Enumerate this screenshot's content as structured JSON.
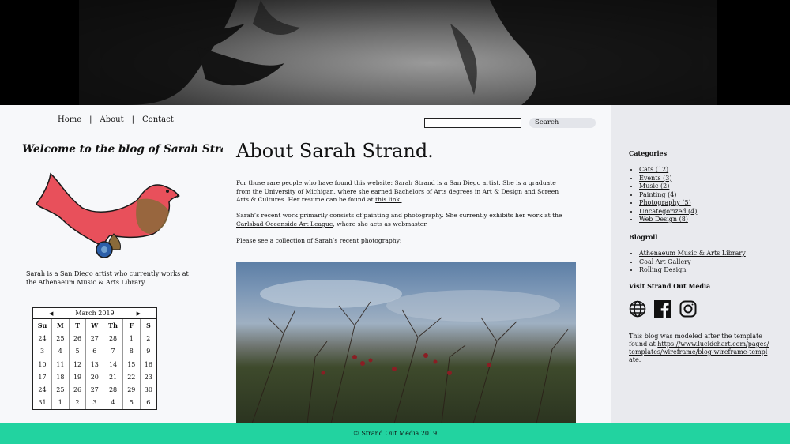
{
  "nav": {
    "home": "Home",
    "about": "About",
    "contact": "Contact",
    "sep": "|"
  },
  "search": {
    "button": "Search",
    "placeholder": ""
  },
  "sidebar_left": {
    "welcome": "Welcome to the blog of Sarah Strand.",
    "bio": "Sarah is a San Diego artist who currently works at the Athenaeum Music & Arts Library.",
    "calendar": {
      "month": "March 2019",
      "prev_icon": "◀",
      "next_icon": "▶",
      "days": [
        "Su",
        "M",
        "T",
        "W",
        "Th",
        "F",
        "S"
      ],
      "weeks": [
        [
          "24",
          "25",
          "26",
          "27",
          "28",
          "1",
          "2"
        ],
        [
          "3",
          "4",
          "5",
          "6",
          "7",
          "8",
          "9"
        ],
        [
          "10",
          "11",
          "12",
          "13",
          "14",
          "15",
          "16"
        ],
        [
          "17",
          "18",
          "19",
          "20",
          "21",
          "22",
          "23"
        ],
        [
          "24",
          "25",
          "26",
          "27",
          "28",
          "29",
          "30"
        ],
        [
          "31",
          "1",
          "2",
          "3",
          "4",
          "5",
          "6"
        ]
      ]
    }
  },
  "main": {
    "title": "About Sarah Strand.",
    "p1_text": "For those rare people who have found this website: Sarah Strand is a San Diego artist. She is a graduate from the University of Michigan, where she earned Bachelors of Arts degrees in Art & Design and Screen Arts & Cultures. Her resume can be found at ",
    "p1_link": "this link.",
    "p2_text": "Sarah’s recent work primarily consists of painting and photography. She currently exhibits her work at the ",
    "p2_link": "Carlsbad Oceanside Art League",
    "p2_tail": ", where she acts as webmaster.",
    "p3": "Please see a collection of Sarah’s recent photography:"
  },
  "sidebar_right": {
    "categories_heading": "Categories",
    "categories": [
      "Cats (12)",
      "Events (3)",
      "Music (2)",
      "Painting (4)",
      "Photography (5)",
      "Uncategorized (4)",
      "Web Design (8)"
    ],
    "blogroll_heading": "Blogroll",
    "blogroll": [
      "Athenaeum Music & Arts Library",
      "Coal Art Gallery",
      "Rolling Design"
    ],
    "visit_heading": "Visit Strand Out Media",
    "social_icons": [
      "globe-icon",
      "facebook-icon",
      "instagram-icon"
    ],
    "modeled_text": "This blog was modeled after the template found at ",
    "modeled_link": "https://www.lucidchart.com/pages/templates/wireframe/blog-wireframe-template",
    "modeled_tail": "."
  },
  "footer": {
    "text": "© Strand Out Media 2019"
  },
  "colors": {
    "footer": "#22d3a0",
    "right_panel": "#e9eaee",
    "page_bg": "#f7f8fa"
  }
}
